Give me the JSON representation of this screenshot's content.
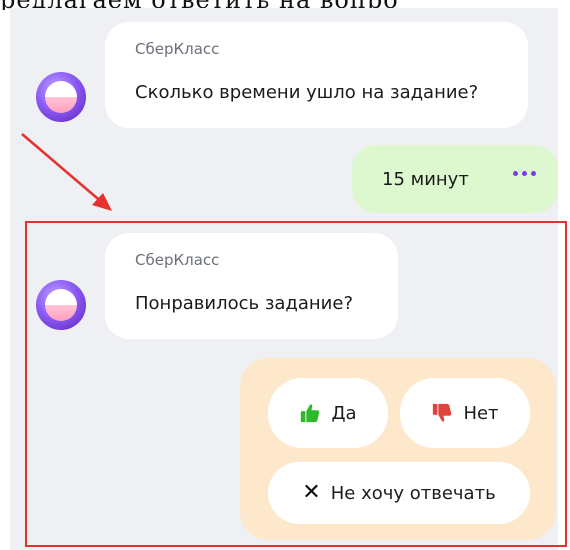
{
  "page": {
    "cut_text": "редлагаем ответить на вопро"
  },
  "chat": {
    "messages": [
      {
        "sender": "СберКласс",
        "text": "Сколько времени ушло на задание?"
      },
      {
        "sender": "СберКласс",
        "text": "Понравилось задание?"
      }
    ],
    "user_reply": {
      "text": "15 минут",
      "menu_icon": "more-dots-icon"
    },
    "quick_replies": {
      "yes_label": "Да",
      "no_label": "Нет",
      "skip_label": "Не хочу отвечать",
      "yes_icon": "thumbs-up-icon",
      "no_icon": "thumbs-down-icon",
      "skip_icon": "close-icon"
    }
  },
  "colors": {
    "panel_bg": "#eef0f4",
    "reply_bg": "#ddf8cf",
    "options_bg": "#fde8cc",
    "highlight": "#e5322e",
    "accent": "#7c3aed",
    "thumbs_up": "#2eb82e",
    "thumbs_down": "#e0443e"
  }
}
